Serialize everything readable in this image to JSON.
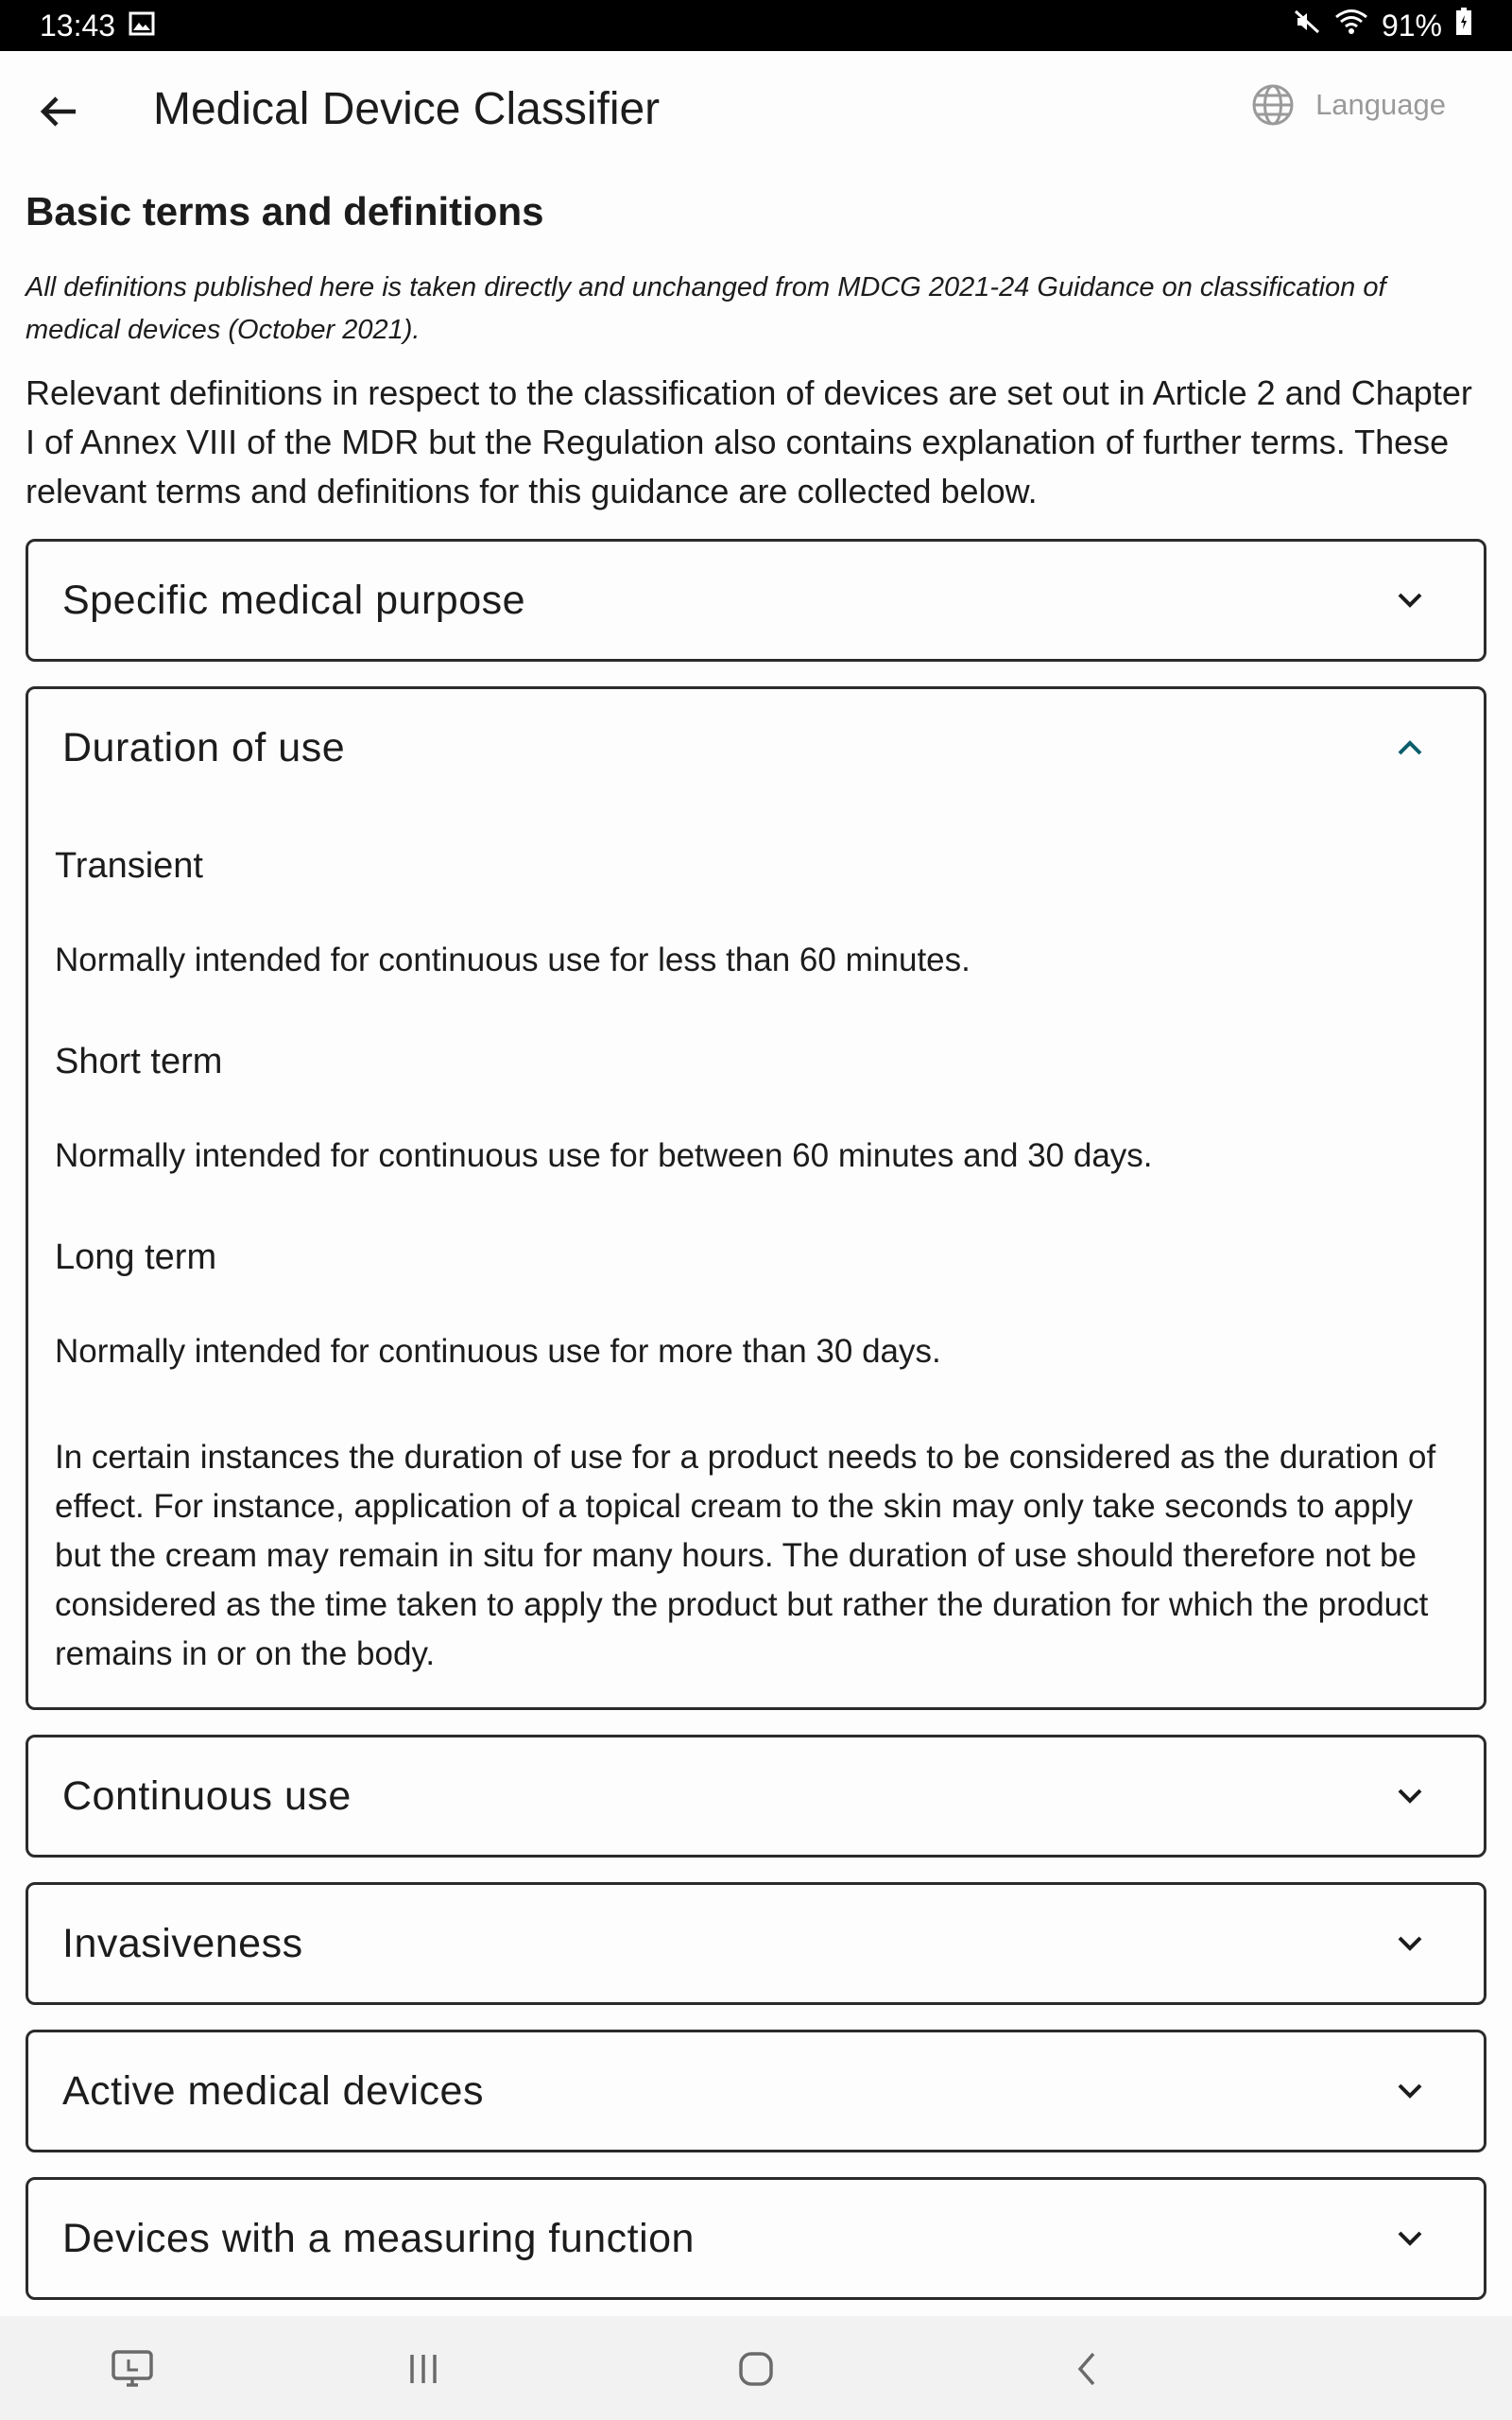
{
  "status_bar": {
    "time": "13:43",
    "battery": "91%",
    "icons": [
      "image-icon",
      "mute-icon",
      "wifi-icon",
      "battery-icon"
    ]
  },
  "app_bar": {
    "title": "Medical Device Classifier",
    "language_label": "Language"
  },
  "page": {
    "section_title": "Basic terms and definitions",
    "intro_italic": "All definitions published here is taken directly and unchanged from MDCG 2021-24 Guidance on classification of medical devices (October 2021).",
    "intro_text": "Relevant definitions in respect to the classification of devices are set out in Article 2 and Chapter I of Annex VIII of the MDR but the Regulation also contains explanation of further terms. These relevant terms and definitions for this guidance are collected below."
  },
  "accordion": {
    "items": [
      {
        "title": "Specific medical purpose",
        "expanded": false
      },
      {
        "title": "Duration of use",
        "expanded": true,
        "terms": [
          {
            "term": "Transient",
            "definition": "Normally intended for continuous use for less than 60 minutes."
          },
          {
            "term": "Short term",
            "definition": "Normally intended for continuous use for between 60 minutes and 30 days."
          },
          {
            "term": "Long term",
            "definition": "Normally intended for continuous use for more than 30 days."
          }
        ],
        "note": "In certain instances the duration of use for a product needs to be considered as the duration of effect. For instance, application of a topical cream to the skin may only take seconds to apply but the cream may remain in situ for many hours. The duration of use should therefore not be considered as the time taken to apply the product but rather the duration for which the product remains in or on the body."
      },
      {
        "title": "Continuous use",
        "expanded": false
      },
      {
        "title": "Invasiveness",
        "expanded": false
      },
      {
        "title": "Active medical devices",
        "expanded": false
      },
      {
        "title": "Devices with a measuring function",
        "expanded": false
      }
    ]
  },
  "colors": {
    "accent": "#0b5e6b",
    "border": "#2b2b2b",
    "muted": "#9a9a9a"
  }
}
